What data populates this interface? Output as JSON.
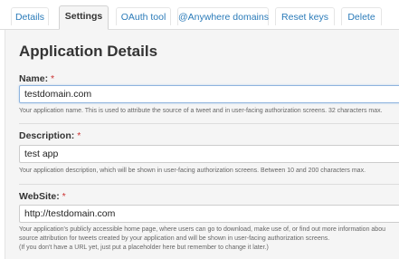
{
  "tabs": [
    {
      "label": "Details"
    },
    {
      "label": "Settings"
    },
    {
      "label": "OAuth tool"
    },
    {
      "label": "@Anywhere domains"
    },
    {
      "label": "Reset keys"
    },
    {
      "label": "Delete"
    }
  ],
  "active_tab": "Settings",
  "page": {
    "title": "Application Details"
  },
  "fields": {
    "name": {
      "label": "Name:",
      "required_mark": "*",
      "value": "testdomain.com",
      "help": "Your application name. This is used to attribute the source of a tweet and in user-facing authorization screens. 32 characters max."
    },
    "description": {
      "label": "Description:",
      "required_mark": "*",
      "value": "test app",
      "help": "Your application description, which will be shown in user-facing authorization screens. Between 10 and 200 characters max."
    },
    "website": {
      "label": "WebSite:",
      "required_mark": "*",
      "value": "http://testdomain.com",
      "help_lines": [
        "Your application's publicly accessible home page, where users can go to download, make use of, or find out more information abou",
        "source attribution for tweets created by your application and will be shown in user-facing authorization screens.",
        "(If you don't have a URL yet, just put a placeholder here but remember to change it later.)"
      ]
    }
  },
  "colors": {
    "link": "#2b7bb9",
    "panel_bg": "#f5f5f5",
    "required": "#cc3333"
  }
}
